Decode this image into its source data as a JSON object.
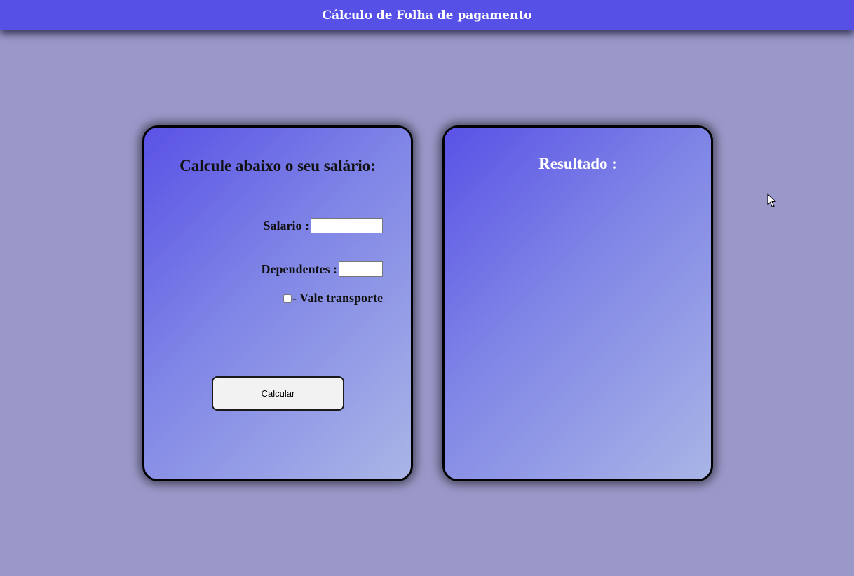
{
  "header": {
    "title": "Cálculo de Folha de pagamento"
  },
  "form_card": {
    "title": "Calcule abaixo o seu salário:",
    "salario_label": "Salario :",
    "salario_value": "",
    "dependentes_label": "Dependentes :",
    "dependentes_value": "",
    "vale_transporte_label": "- Vale transporte",
    "vale_transporte_checked": false,
    "calculate_button_label": "Calcular"
  },
  "result_card": {
    "title": "Resultado :"
  },
  "colors": {
    "page_background": "#9a98c8",
    "header_background": "#5650e6",
    "card_gradient_start": "#5a52e6",
    "card_gradient_end": "#a9b5e6"
  },
  "icons": {
    "cursor": "mouse-pointer-icon"
  }
}
